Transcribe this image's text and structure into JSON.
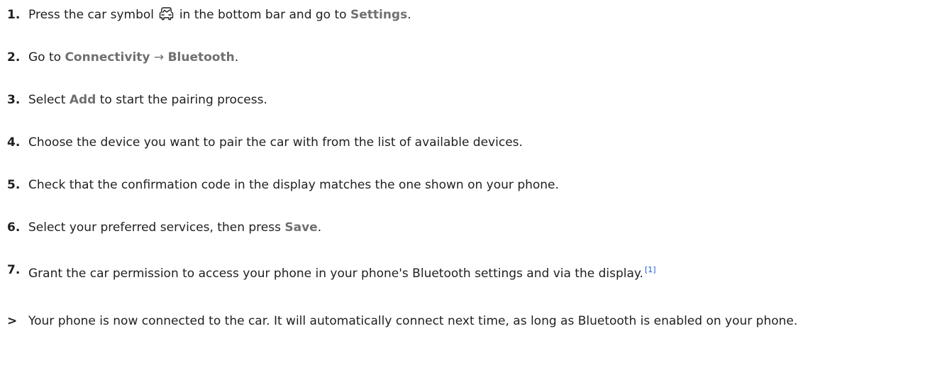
{
  "steps": [
    {
      "marker": "1.",
      "text_before_icon": "Press the car symbol",
      "icon": "car-icon",
      "text_after_icon": "in the bottom bar and go to",
      "highlight": "Settings",
      "text_end": "."
    },
    {
      "marker": "2.",
      "text_before": "Go to",
      "highlight_1": "Connectivity",
      "arrow": "→",
      "highlight_2": "Bluetooth",
      "text_end": "."
    },
    {
      "marker": "3.",
      "text_before": "Select",
      "highlight": "Add",
      "text_after": "to start the pairing process."
    },
    {
      "marker": "4.",
      "text": "Choose the device you want to pair the car with from the list of available devices."
    },
    {
      "marker": "5.",
      "text": "Check that the confirmation code in the display matches the one shown on your phone."
    },
    {
      "marker": "6.",
      "text_before": "Select your preferred services, then press",
      "highlight": "Save",
      "text_end": "."
    },
    {
      "marker": "7.",
      "text": "Grant the car permission to access your phone in your phone's Bluetooth settings and via the display.",
      "footnote": "[1]"
    },
    {
      "marker": ">",
      "text": "Your phone is now connected to the car. It will automatically connect next time, as long as Bluetooth is enabled on your phone."
    }
  ],
  "colors": {
    "text": "#1f1f1f",
    "ui_highlight": "#707070",
    "footnote_link": "#1c5bd1"
  }
}
